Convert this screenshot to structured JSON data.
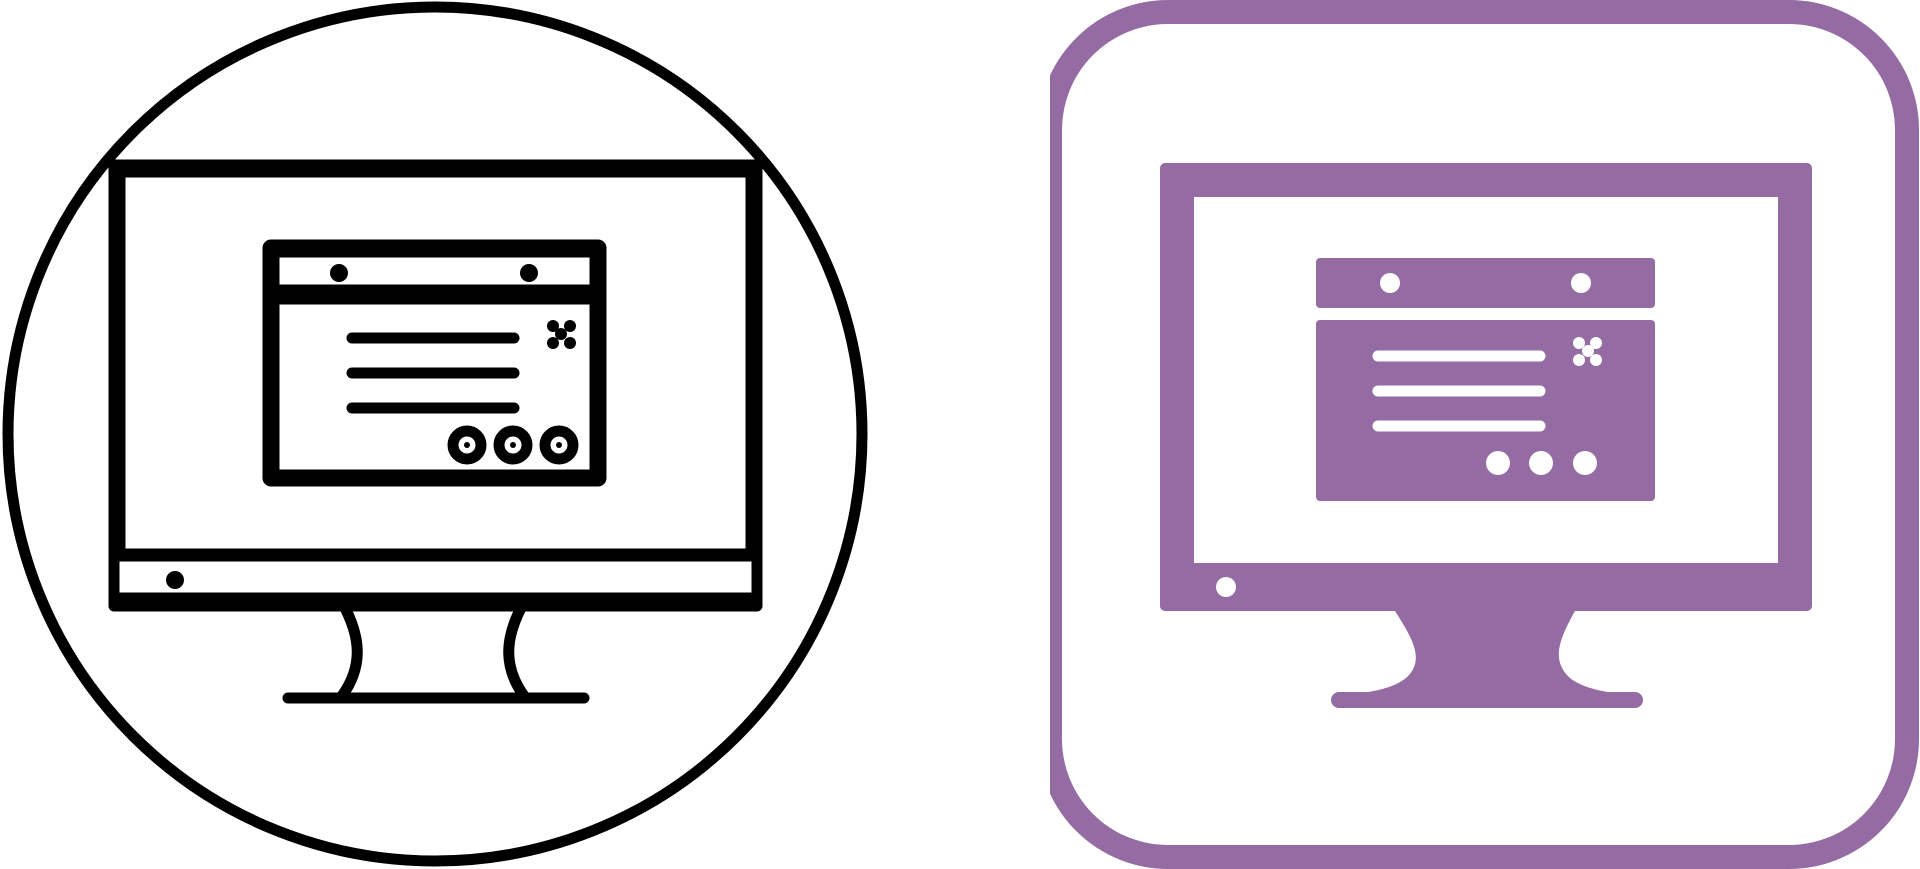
{
  "icons": {
    "outline": {
      "name": "monitor-popup-outline-icon",
      "style": "line",
      "stroke_color": "#000000",
      "background": "#ffffff",
      "container_shape": "circle"
    },
    "glyph": {
      "name": "monitor-popup-glyph-icon",
      "style": "filled",
      "fill_color": "#956ba3",
      "background": "#ffffff",
      "container_shape": "rounded-square"
    }
  }
}
